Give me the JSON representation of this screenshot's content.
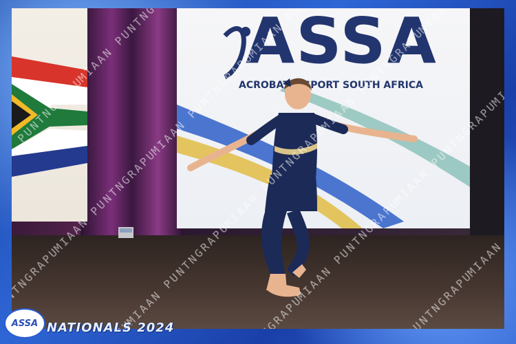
{
  "banner": {
    "logo_text": "ASSA",
    "subtitle": "ACROBATIC SPORT SOUTH AFRICA"
  },
  "watermark": {
    "text": "MIAAN PUNTNGRAPUY"
  },
  "caption": {
    "event": "NATIONALS 2024",
    "badge": "ASSA"
  },
  "colors": {
    "frame_blue": "#2e66d6",
    "leotard_navy": "#1c2a57",
    "banner_text": "#23356e",
    "banner_green": "#5aa89a"
  }
}
